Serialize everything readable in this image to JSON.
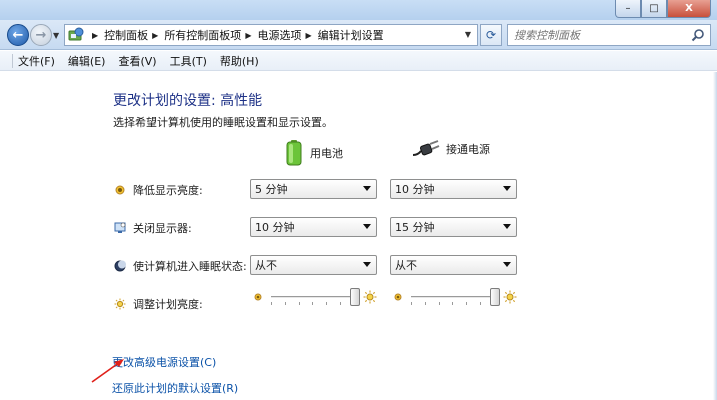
{
  "window": {
    "minimize_label": "–",
    "maximize_label": "□",
    "close_label": "X"
  },
  "nav": {
    "breadcrumbs": [
      "控制面板",
      "所有控制面板项",
      "电源选项",
      "编辑计划设置"
    ],
    "search_placeholder": "搜索控制面板"
  },
  "menu": {
    "items": [
      "文件(F)",
      "编辑(E)",
      "查看(V)",
      "工具(T)",
      "帮助(H)"
    ]
  },
  "plan": {
    "title": "更改计划的设置: 高性能",
    "description": "选择希望计算机使用的睡眠设置和显示设置。",
    "columns": {
      "battery": "用电池",
      "plugged": "接通电源"
    },
    "rows": {
      "dim": {
        "label": "降低显示亮度:",
        "battery": "5 分钟",
        "plugged": "10 分钟"
      },
      "display_off": {
        "label": "关闭显示器:",
        "battery": "10 分钟",
        "plugged": "15 分钟"
      },
      "sleep": {
        "label": "使计算机进入睡眠状态:",
        "battery": "从不",
        "plugged": "从不"
      },
      "brightness": {
        "label": "调整计划亮度:",
        "battery_level": 1.0,
        "plugged_level": 1.0
      }
    },
    "links": {
      "advanced": "更改高级电源设置(C)",
      "restore": "还原此计划的默认设置(R)"
    }
  },
  "colors": {
    "title": "#1e3287",
    "link": "#0b52a8",
    "annotation_arrow": "#e0201a"
  },
  "icons": {
    "back": "back-arrow-icon",
    "forward": "forward-arrow-icon",
    "refresh": "refresh-icon",
    "search": "search-icon",
    "battery": "battery-icon",
    "plug": "power-plug-icon",
    "dim": "sun-dim-icon",
    "monitor": "monitor-icon",
    "sleep": "moon-icon",
    "brightness": "sun-icon"
  }
}
